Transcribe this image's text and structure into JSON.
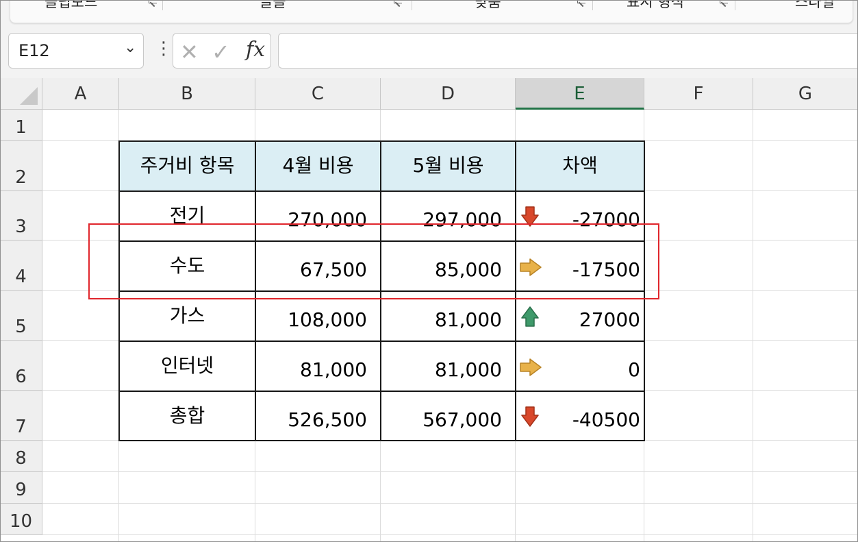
{
  "ribbon": {
    "groups": [
      {
        "label": "클립보드"
      },
      {
        "label": "글꼴"
      },
      {
        "label": "맞춤"
      },
      {
        "label": "표시 형식"
      },
      {
        "label": "스타일"
      }
    ]
  },
  "formula_bar": {
    "name_box": "E12",
    "fx_label": "fx",
    "formula": ""
  },
  "columns": [
    "A",
    "B",
    "C",
    "D",
    "E",
    "F",
    "G"
  ],
  "selected_column": "E",
  "rows": [
    "1",
    "2",
    "3",
    "4",
    "5",
    "6",
    "7",
    "8",
    "9",
    "10"
  ],
  "table": {
    "headers": [
      "주거비 항목",
      "4월 비용",
      "5월 비용",
      "차액"
    ],
    "rows": [
      {
        "item": "전기",
        "april": "270,000",
        "may": "297,000",
        "diff": "-27000",
        "icon": "down-arrow-icon"
      },
      {
        "item": "수도",
        "april": "67,500",
        "may": "85,000",
        "diff": "-17500",
        "icon": "right-arrow-icon"
      },
      {
        "item": "가스",
        "april": "108,000",
        "may": "81,000",
        "diff": "27000",
        "icon": "up-arrow-icon"
      },
      {
        "item": "인터넷",
        "april": "81,000",
        "may": "81,000",
        "diff": "0",
        "icon": "right-arrow-icon"
      },
      {
        "item": "총합",
        "april": "526,500",
        "may": "567,000",
        "diff": "-40500",
        "icon": "down-arrow-icon"
      }
    ]
  },
  "colors": {
    "header_fill": "#dbeef4",
    "down_arrow": "#d9482b",
    "right_arrow": "#e8b24a",
    "up_arrow": "#3f9a6b",
    "highlight_box": "#e0262c",
    "selected_column_accent": "#217346"
  }
}
